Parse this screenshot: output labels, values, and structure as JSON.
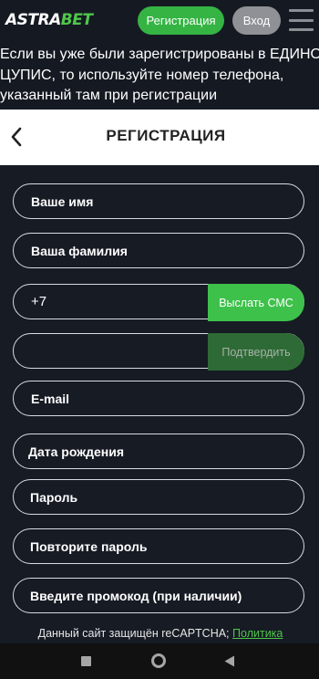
{
  "topbar": {
    "logo_part1": "ASTRA",
    "logo_part2": "BET",
    "register_label": "Регистрация",
    "login_label": "Вход"
  },
  "notice": {
    "lines": [
      "Если вы уже были зарегистрированы в ЕДИНОМ",
      "ЦУПИС, то используйте номер телефона,",
      "указанный там при регистрации"
    ]
  },
  "header": {
    "title": "РЕГИСТРАЦИЯ"
  },
  "form": {
    "first_name": "Ваше имя",
    "last_name": "Ваша фамилия",
    "phone_prefix": "+7",
    "send_sms_label": "Выслать СМС",
    "code_value": "",
    "confirm_label": "Подтвердить",
    "email": "E-mail",
    "birth_date": "Дата рождения",
    "password": "Пароль",
    "repeat_password": "Повторите пароль",
    "promo_code": "Введите промокод (при наличии)"
  },
  "captcha": {
    "text": "Данный сайт защищён reCAPTCHA;",
    "link": "Политика"
  },
  "colors": {
    "accent_green": "#3ec14b",
    "dark_green": "#2e6a35",
    "background": "#161b24"
  }
}
